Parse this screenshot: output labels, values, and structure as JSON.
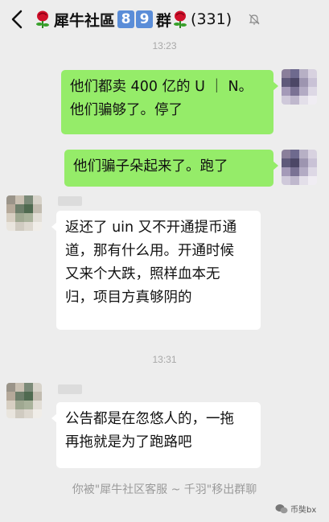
{
  "header": {
    "title_name": "犀牛社區",
    "badge_1": "8",
    "badge_2": "9",
    "title_suffix": "群",
    "member_count": "(331)"
  },
  "timestamps": [
    "13:23",
    "13:31"
  ],
  "messages": [
    {
      "side": "right",
      "lines": [
        "他们都卖 400 亿的 U ｜ N。",
        "他们骗够了。停了"
      ]
    },
    {
      "side": "right",
      "lines": [
        "他们骗子朵起来了。跑了"
      ]
    },
    {
      "side": "left",
      "lines": [
        "返还了 uin 又不开通提币通",
        "道，那有什么用。开通时候",
        "又来个大跌，照样血本无",
        "归，项目方真够阴的"
      ]
    },
    {
      "side": "left",
      "lines": [
        "公告都是在忽悠人的，一拖",
        "再拖就是为了跑路吧"
      ]
    }
  ],
  "system_message": "你被\"犀牛社区客服 ~ 千羽\"移出群聊",
  "watermark": "币奘bx",
  "colors": {
    "bg": "#ededed",
    "bubble_right": "#95ec69",
    "bubble_left": "#ffffff",
    "badge": "#5a8dd8"
  },
  "icons": [
    "back-icon",
    "rose-icon",
    "mute-icon",
    "wechat-icon"
  ]
}
